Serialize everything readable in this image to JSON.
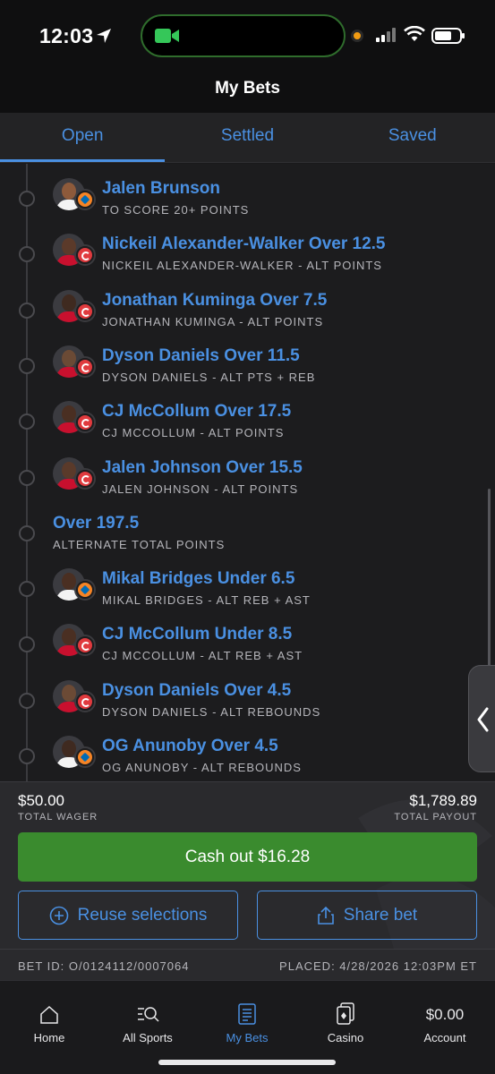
{
  "status_bar": {
    "time": "12:03"
  },
  "header": {
    "title": "My Bets"
  },
  "tabs": [
    {
      "label": "Open",
      "active": true
    },
    {
      "label": "Settled",
      "active": false
    },
    {
      "label": "Saved",
      "active": false
    }
  ],
  "legs": [
    {
      "title": "Jalen Brunson",
      "subtitle": "TO SCORE 20+ POINTS",
      "team": "nyk",
      "skin": "#8d5a3b",
      "jersey": "#f3f3f3"
    },
    {
      "title": "Nickeil Alexander-Walker Over 12.5",
      "subtitle": "NICKEIL ALEXANDER-WALKER - ALT POINTS",
      "team": "atl",
      "skin": "#5b3a2a",
      "jersey": "#c8102e"
    },
    {
      "title": "Jonathan Kuminga Over 7.5",
      "subtitle": "JONATHAN KUMINGA - ALT POINTS",
      "team": "atl",
      "skin": "#3f2a20",
      "jersey": "#c8102e"
    },
    {
      "title": "Dyson Daniels Over 11.5",
      "subtitle": "DYSON DANIELS - ALT PTS + REB",
      "team": "atl",
      "skin": "#6b4a35",
      "jersey": "#c8102e"
    },
    {
      "title": "CJ McCollum Over 17.5",
      "subtitle": "CJ MCCOLLUM - ALT POINTS",
      "team": "atl",
      "skin": "#4a2f22",
      "jersey": "#c8102e"
    },
    {
      "title": "Jalen Johnson Over 15.5",
      "subtitle": "JALEN JOHNSON - ALT POINTS",
      "team": "atl",
      "skin": "#5a3a2a",
      "jersey": "#c8102e"
    },
    {
      "title": "Over 197.5",
      "subtitle": "ALTERNATE TOTAL POINTS",
      "team": "",
      "skin": "",
      "jersey": ""
    },
    {
      "title": "Mikal Bridges Under 6.5",
      "subtitle": "MIKAL BRIDGES - ALT REB + AST",
      "team": "nyk",
      "skin": "#4a2f22",
      "jersey": "#f3f3f3"
    },
    {
      "title": "CJ McCollum Under 8.5",
      "subtitle": "CJ MCCOLLUM - ALT REB + AST",
      "team": "atl",
      "skin": "#4a2f22",
      "jersey": "#c8102e"
    },
    {
      "title": "Dyson Daniels Over 4.5",
      "subtitle": "DYSON DANIELS - ALT REBOUNDS",
      "team": "atl",
      "skin": "#6b4a35",
      "jersey": "#c8102e"
    },
    {
      "title": "OG Anunoby Over 4.5",
      "subtitle": "OG ANUNOBY - ALT REBOUNDS",
      "team": "nyk",
      "skin": "#3f2a20",
      "jersey": "#f3f3f3"
    }
  ],
  "summary": {
    "wager_amount": "$50.00",
    "wager_label": "TOTAL WAGER",
    "payout_amount": "$1,789.89",
    "payout_label": "TOTAL PAYOUT",
    "cashout_label": "Cash out $16.28",
    "reuse_label": "Reuse selections",
    "share_label": "Share bet",
    "bet_id": "BET ID: O/0124112/0007064",
    "placed": "PLACED: 4/28/2026 12:03PM ET"
  },
  "nav": {
    "home": "Home",
    "all_sports": "All Sports",
    "my_bets": "My Bets",
    "casino": "Casino",
    "balance": "$0.00",
    "account": "Account"
  },
  "colors": {
    "accent": "#4a90e2",
    "cashout": "#3a8b2e",
    "atl": "#e03a3e",
    "nyk": "#f58426"
  }
}
